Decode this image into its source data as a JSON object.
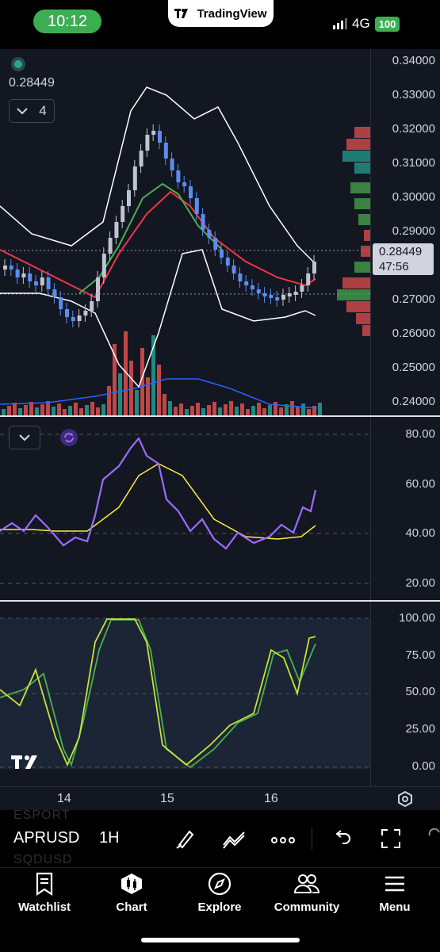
{
  "status": {
    "time": "10:12",
    "network": "4G",
    "battery": "100",
    "brand": "TradingView"
  },
  "chart": {
    "legend_price": "0.28449",
    "indicator_count": "4",
    "current_price": "0.28449",
    "countdown": "47:56",
    "price_axis": [
      "0.34000",
      "0.33000",
      "0.32000",
      "0.31000",
      "0.30000",
      "0.29000",
      "0.27000",
      "0.26000",
      "0.25000",
      "0.24000"
    ],
    "rsi_axis": [
      "80.00",
      "60.00",
      "40.00",
      "20.00"
    ],
    "stoch_axis": [
      "100.00",
      "75.00",
      "50.00",
      "25.00",
      "0.00"
    ],
    "time_axis": [
      "14",
      "15",
      "16"
    ],
    "colors": {
      "up": "#5b8def",
      "down": "#5b8def",
      "bb": "#ffffff",
      "ema_fast": "#f23645",
      "ema_slow": "#4caf50",
      "rsi": "#9c6bff",
      "rsi_ma": "#ffeb3b",
      "stoch_k": "#c6e33b",
      "stoch_d": "#4caf50",
      "volume_up": "#26a69a",
      "volume_down": "#ef5350"
    }
  },
  "toolbar": {
    "symbol": "APRUSD",
    "interval": "1H",
    "ghost_above": "ESPORT",
    "ghost_below": "SQDUSD"
  },
  "nav": [
    {
      "label": "Watchlist",
      "icon": "bookmark-icon"
    },
    {
      "label": "Chart",
      "icon": "candles-icon"
    },
    {
      "label": "Explore",
      "icon": "compass-icon"
    },
    {
      "label": "Community",
      "icon": "people-icon"
    },
    {
      "label": "Menu",
      "icon": "hamburger-icon"
    }
  ]
}
